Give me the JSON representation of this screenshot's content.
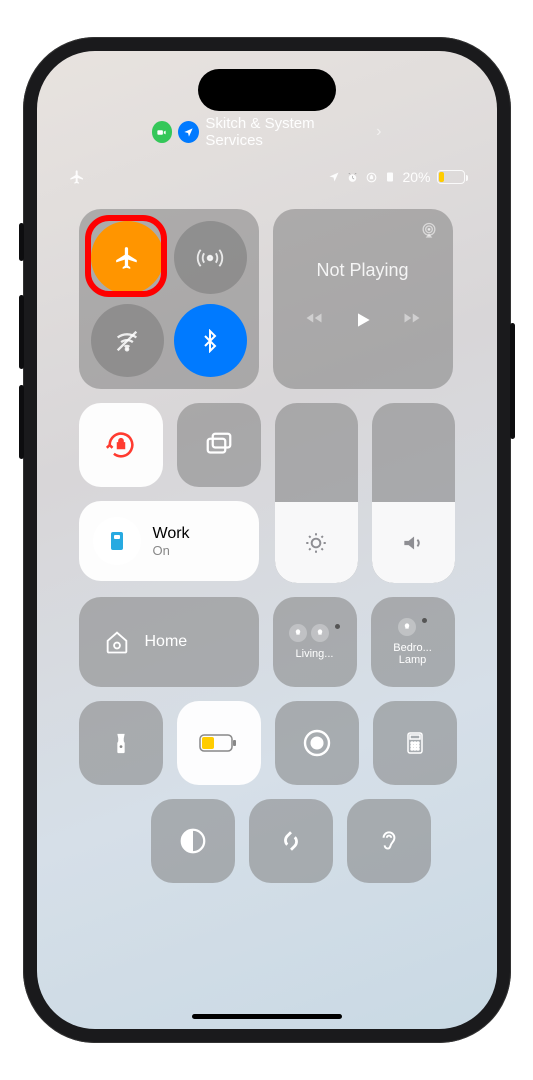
{
  "bg_apps": {
    "label": "Skitch & System Services"
  },
  "status": {
    "battery_pct": "20%"
  },
  "connectivity": {
    "airplane": {
      "on": true
    },
    "cellular": {
      "on": false
    },
    "wifi": {
      "on": false
    },
    "bluetooth": {
      "on": true
    }
  },
  "media": {
    "title": "Not Playing"
  },
  "focus": {
    "name": "Work",
    "state": "On"
  },
  "brightness": {
    "level": 0.45
  },
  "volume": {
    "level": 0.45
  },
  "home": {
    "label": "Home"
  },
  "homekit": [
    {
      "label": "Living..."
    },
    {
      "label": "Bedro...",
      "sub": "Lamp"
    }
  ]
}
